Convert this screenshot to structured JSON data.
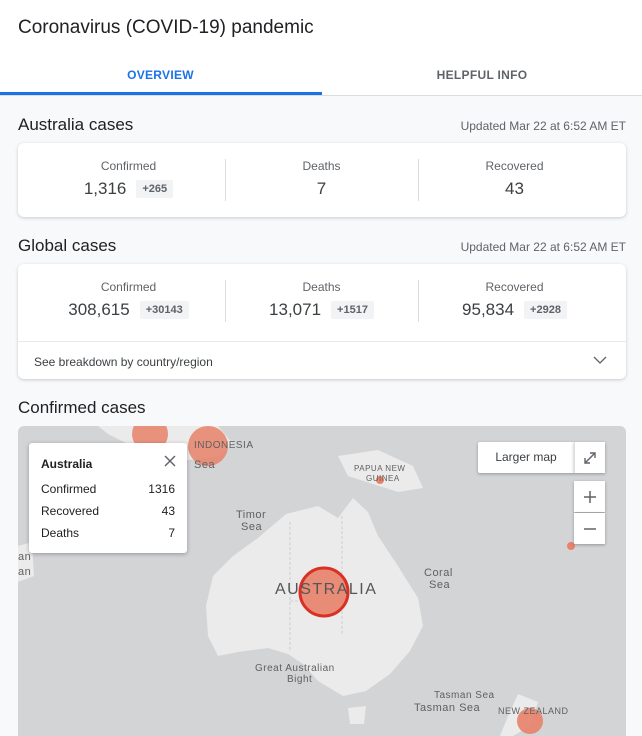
{
  "header": {
    "title": "Coronavirus (COVID-19) pandemic",
    "tabs": [
      "OVERVIEW",
      "HELPFUL INFO"
    ],
    "active_tab": "OVERVIEW"
  },
  "australia": {
    "title": "Australia cases",
    "updated": "Updated Mar 22 at 6:52 AM ET",
    "stats": [
      {
        "label": "Confirmed",
        "value": "1,316",
        "delta": "+265"
      },
      {
        "label": "Deaths",
        "value": "7",
        "delta": ""
      },
      {
        "label": "Recovered",
        "value": "43",
        "delta": ""
      }
    ]
  },
  "global": {
    "title": "Global cases",
    "updated": "Updated Mar 22 at 6:52 AM ET",
    "stats": [
      {
        "label": "Confirmed",
        "value": "308,615",
        "delta": "+30143"
      },
      {
        "label": "Deaths",
        "value": "13,071",
        "delta": "+1517"
      },
      {
        "label": "Recovered",
        "value": "95,834",
        "delta": "+2928"
      }
    ],
    "breakdown_label": "See breakdown by country/region"
  },
  "confirmed": {
    "title": "Confirmed cases",
    "map": {
      "larger_map_label": "Larger map",
      "popup": {
        "title": "Australia",
        "rows": [
          {
            "label": "Confirmed",
            "value": "1316"
          },
          {
            "label": "Recovered",
            "value": "43"
          },
          {
            "label": "Deaths",
            "value": "7"
          }
        ]
      },
      "labels": {
        "indonesia": "INDONESIA",
        "sea_fragment": "Sea",
        "png_line1": "PAPUA NEW",
        "png_line2": "GUINEA",
        "timor_line1": "Timor",
        "timor_line2": "Sea",
        "australia": "AUSTRALIA",
        "coral_line1": "Coral",
        "coral_line2": "Sea",
        "gab_line1": "Great Australian",
        "gab_line2": "Bight",
        "tasman1": "Tasman Sea",
        "tasman2": "Tasman Sea",
        "nz": "NEW ZEALAND",
        "left_fragment1": "an",
        "left_fragment2": "an"
      },
      "colors": {
        "land": "#ebebeb",
        "water": "#d3d4d6",
        "bubble": "#e8826a",
        "bubble_selected": "#d93025"
      }
    }
  }
}
